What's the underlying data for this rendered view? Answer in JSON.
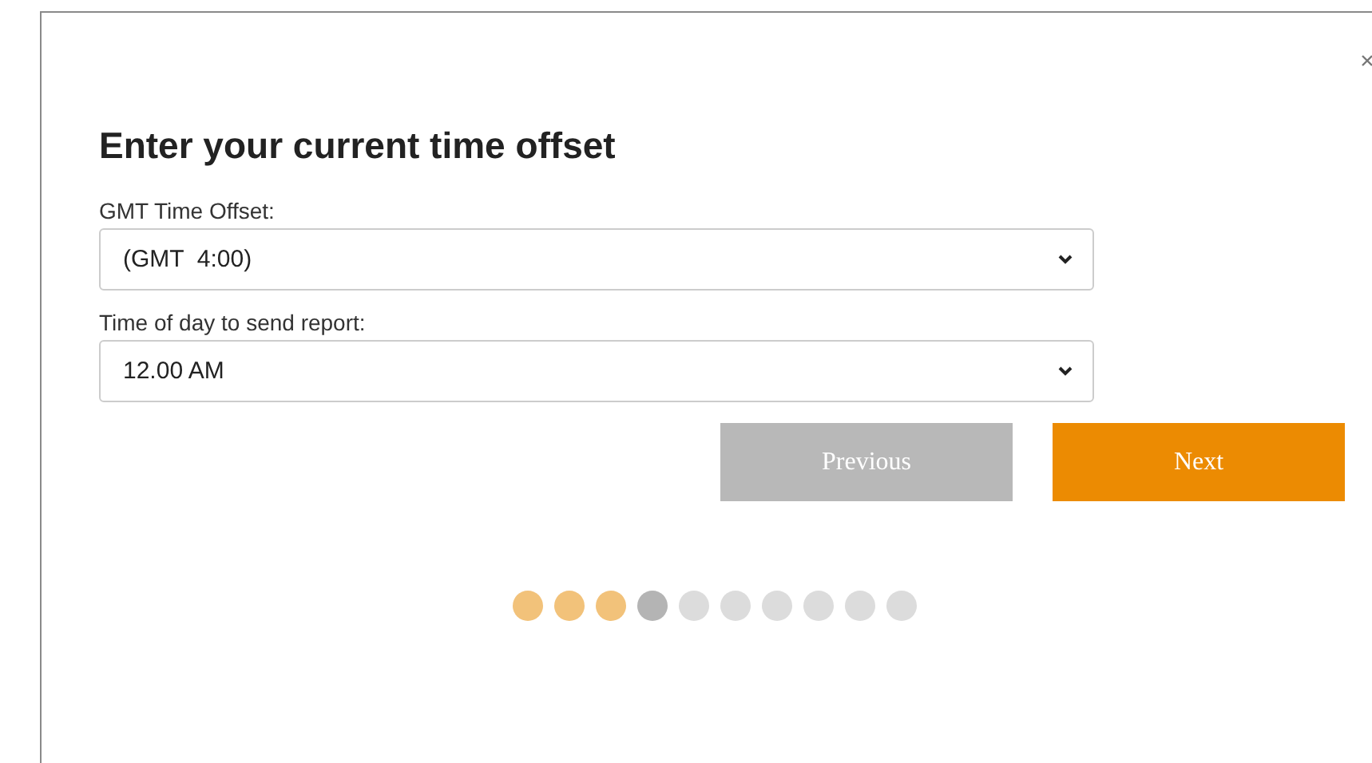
{
  "dialog": {
    "title": "Enter your current time offset",
    "fields": [
      {
        "label": "GMT Time Offset:",
        "value": "(GMT  4:00)"
      },
      {
        "label": "Time of day to send report:",
        "value": "12.00 AM"
      }
    ],
    "buttons": [
      {
        "label": "Previous",
        "kind": "secondary"
      },
      {
        "label": "Next",
        "kind": "primary"
      }
    ],
    "steps": [
      {
        "completed": true,
        "selected": false
      },
      {
        "completed": true,
        "selected": false
      },
      {
        "completed": true,
        "selected": false
      },
      {
        "completed": false,
        "selected": true
      },
      {
        "completed": false,
        "selected": false
      },
      {
        "completed": false,
        "selected": false
      },
      {
        "completed": false,
        "selected": false
      },
      {
        "completed": false,
        "selected": false
      },
      {
        "completed": false,
        "selected": false
      },
      {
        "completed": false,
        "selected": false
      }
    ]
  }
}
